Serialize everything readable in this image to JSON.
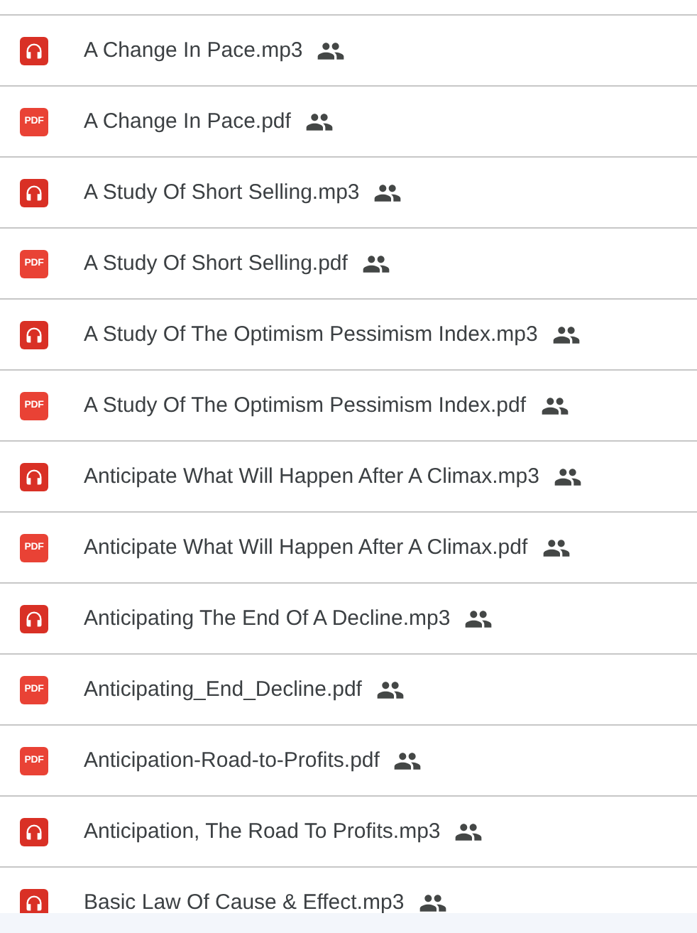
{
  "files": [
    {
      "name": "A Change In Pace.mp3",
      "kind": "audio",
      "shared": true
    },
    {
      "name": "A Change In Pace.pdf",
      "kind": "pdf",
      "badge": "PDF",
      "shared": true
    },
    {
      "name": "A Study Of Short Selling.mp3",
      "kind": "audio",
      "shared": true
    },
    {
      "name": "A Study Of Short Selling.pdf",
      "kind": "pdf",
      "badge": "PDF",
      "shared": true
    },
    {
      "name": "A Study Of The Optimism Pessimism Index.mp3",
      "kind": "audio",
      "shared": true
    },
    {
      "name": "A Study Of The Optimism Pessimism Index.pdf",
      "kind": "pdf",
      "badge": "PDF",
      "shared": true
    },
    {
      "name": "Anticipate What Will Happen After A Climax.mp3",
      "kind": "audio",
      "shared": true
    },
    {
      "name": "Anticipate What Will Happen After A Climax.pdf",
      "kind": "pdf",
      "badge": "PDF",
      "shared": true
    },
    {
      "name": "Anticipating The End Of A Decline.mp3",
      "kind": "audio",
      "shared": true
    },
    {
      "name": "Anticipating_End_Decline.pdf",
      "kind": "pdf",
      "badge": "PDF",
      "shared": true
    },
    {
      "name": "Anticipation-Road-to-Profits.pdf",
      "kind": "pdf",
      "badge": "PDF",
      "shared": true
    },
    {
      "name": "Anticipation, The Road To Profits.mp3",
      "kind": "audio",
      "shared": true
    },
    {
      "name": "Basic Law Of Cause & Effect.mp3",
      "kind": "audio",
      "shared": true
    }
  ]
}
